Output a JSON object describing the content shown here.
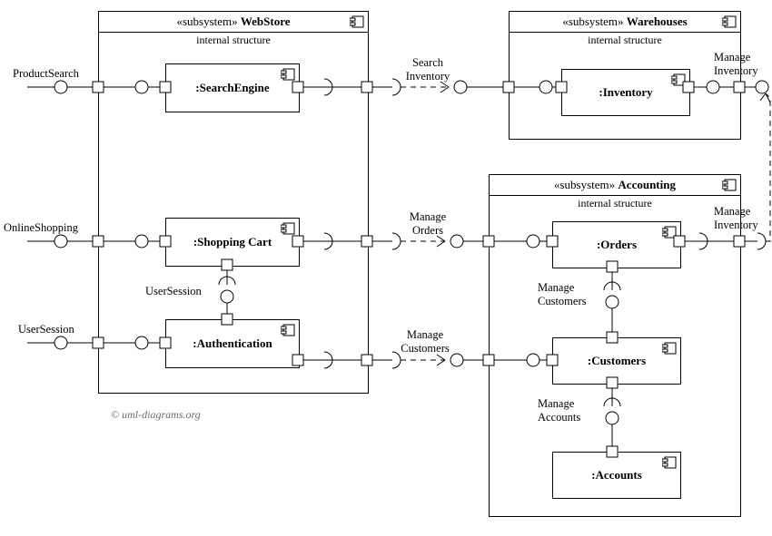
{
  "stereotype": "«subsystem»",
  "internal": "internal structure",
  "copyright": "© uml-diagrams.org",
  "subsystems": {
    "webstore": {
      "name": "WebStore"
    },
    "warehouses": {
      "name": "Warehouses"
    },
    "accounting": {
      "name": "Accounting"
    }
  },
  "components": {
    "searchengine": ":SearchEngine",
    "shoppingcart": ":Shopping Cart",
    "authentication": ":Authentication",
    "inventory": ":Inventory",
    "orders": ":Orders",
    "customers": ":Customers",
    "accounts": ":Accounts"
  },
  "ifaces": {
    "productsearch": "ProductSearch",
    "onlineshopping": "OnlineShopping",
    "usersession_ext": "UserSession",
    "usersession_int": "UserSession",
    "searchinventory": "Search\nInventory",
    "manageorders": "Manage\nOrders",
    "managecustomers_ext": "Manage\nCustomers",
    "managecustomers_int": "Manage\nCustomers",
    "manageaccounts": "Manage\nAccounts",
    "manageinventory_top": "Manage\nInventory",
    "manageinventory_right": "Manage\nInventory"
  },
  "chart_data": {
    "type": "uml-composite-structure",
    "subsystems": [
      {
        "name": "WebStore",
        "parts": [
          "SearchEngine",
          "Shopping Cart",
          "Authentication"
        ]
      },
      {
        "name": "Warehouses",
        "parts": [
          "Inventory"
        ]
      },
      {
        "name": "Accounting",
        "parts": [
          "Orders",
          "Customers",
          "Accounts"
        ]
      }
    ],
    "provided_interfaces": [
      {
        "name": "ProductSearch",
        "by": "WebStore",
        "delegate": "SearchEngine"
      },
      {
        "name": "OnlineShopping",
        "by": "WebStore",
        "delegate": "Shopping Cart"
      },
      {
        "name": "UserSession",
        "by": "WebStore",
        "delegate": "Authentication"
      },
      {
        "name": "Search Inventory",
        "by": "Warehouses",
        "delegate": "Inventory"
      },
      {
        "name": "Manage Orders",
        "by": "Accounting",
        "delegate": "Orders"
      },
      {
        "name": "Manage Customers",
        "by": "Accounting",
        "delegate": "Customers"
      },
      {
        "name": "Manage Inventory",
        "by": "Warehouses",
        "delegate": "Inventory"
      }
    ],
    "required_interfaces": [
      {
        "name": "Search Inventory",
        "by": "WebStore",
        "from": "SearchEngine",
        "to": "Warehouses"
      },
      {
        "name": "Manage Orders",
        "by": "WebStore",
        "from": "Shopping Cart",
        "to": "Accounting"
      },
      {
        "name": "Manage Customers",
        "by": "WebStore",
        "from": "Authentication",
        "to": "Accounting"
      },
      {
        "name": "Manage Inventory",
        "by": "Accounting",
        "from": "Orders",
        "to": "Warehouses"
      }
    ],
    "internal_assemblies": [
      {
        "required_by": "Shopping Cart",
        "provided_by": "Authentication",
        "interface": "UserSession"
      },
      {
        "required_by": "Orders",
        "provided_by": "Customers",
        "interface": "Manage Customers"
      },
      {
        "required_by": "Customers",
        "provided_by": "Accounts",
        "interface": "Manage Accounts"
      }
    ]
  }
}
